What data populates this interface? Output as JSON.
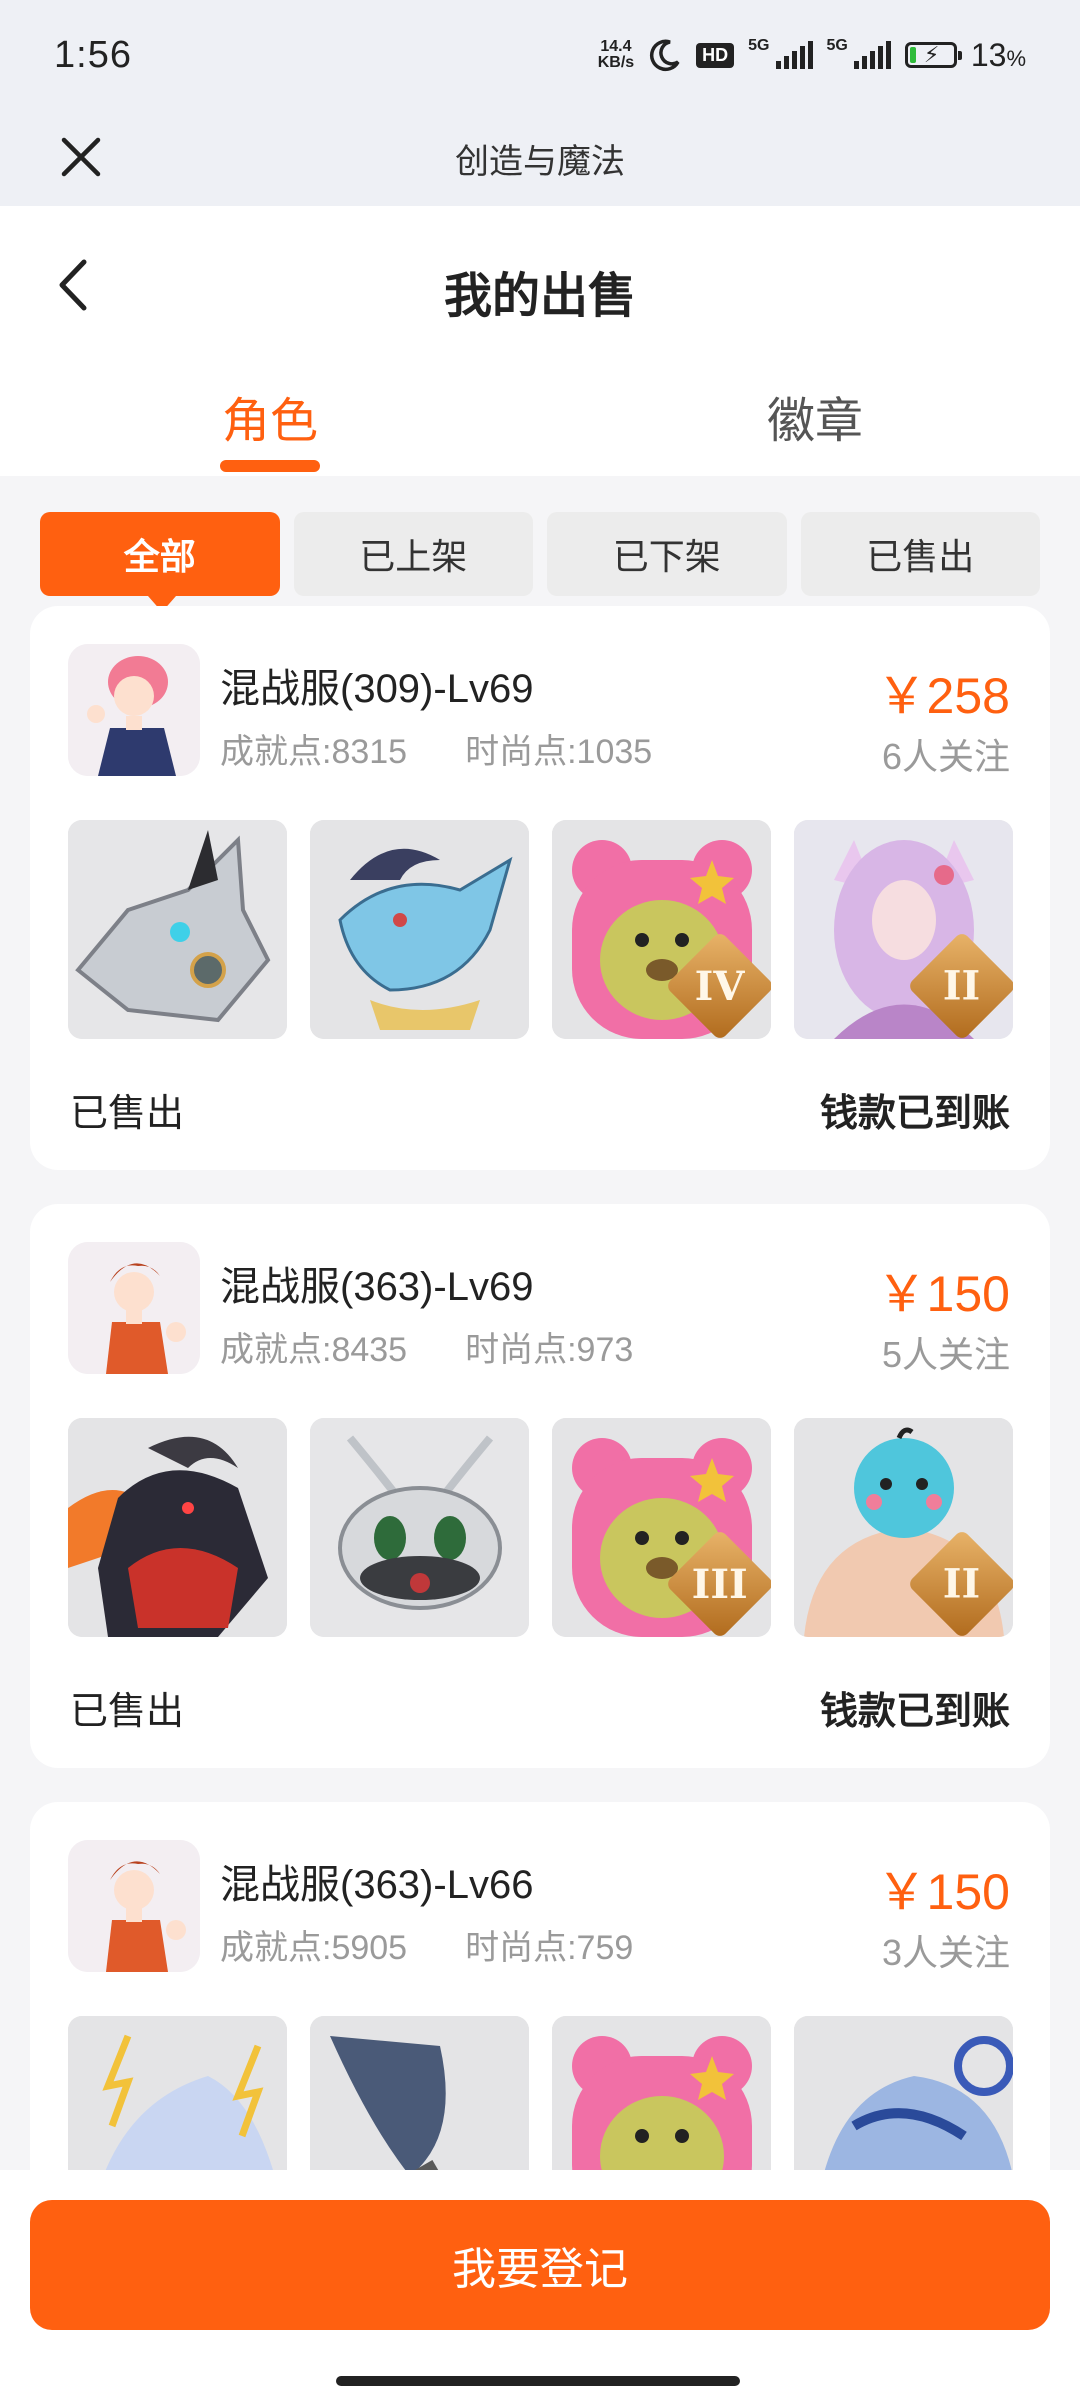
{
  "status_bar": {
    "time": "1:56",
    "net_speed_value": "14.4",
    "net_speed_unit": "KB/s",
    "hd_label": "HD",
    "signal1_label": "5G",
    "signal2_label": "5G",
    "battery_percent": "13",
    "battery_percent_sign": "%"
  },
  "mini_program": {
    "title": "创造与魔法"
  },
  "page": {
    "title": "我的出售",
    "tabs": [
      {
        "label": "角色",
        "active": true
      },
      {
        "label": "徽章",
        "active": false
      }
    ],
    "filters": [
      {
        "label": "全部",
        "active": true
      },
      {
        "label": "已上架",
        "active": false
      },
      {
        "label": "已下架",
        "active": false
      },
      {
        "label": "已售出",
        "active": false
      }
    ]
  },
  "listings": [
    {
      "server": "混战服(309)-Lv69",
      "achievement": "成就点:8315",
      "fashion": "时尚点:1035",
      "price": "￥258",
      "followers": "6人关注",
      "status": "已售出",
      "payment": "钱款已到账",
      "thumbs": [
        {
          "icon": "silver-dragon-mount",
          "rank": ""
        },
        {
          "icon": "blue-dragon-mount",
          "rank": ""
        },
        {
          "icon": "pink-bear-pet",
          "rank": "IV"
        },
        {
          "icon": "fox-spirit-costume",
          "rank": "II"
        }
      ]
    },
    {
      "server": "混战服(363)-Lv69",
      "achievement": "成就点:8435",
      "fashion": "时尚点:973",
      "price": "￥150",
      "followers": "5人关注",
      "status": "已售出",
      "payment": "钱款已到账",
      "thumbs": [
        {
          "icon": "black-goat-beast-mount",
          "rank": ""
        },
        {
          "icon": "white-mecha-bug",
          "rank": ""
        },
        {
          "icon": "pink-bear-pet",
          "rank": "III"
        },
        {
          "icon": "blue-bird-muscle-costume",
          "rank": "II"
        }
      ]
    },
    {
      "server": "混战服(363)-Lv66",
      "achievement": "成就点:5905",
      "fashion": "时尚点:759",
      "price": "￥150",
      "followers": "3人关注",
      "status": "",
      "payment": "",
      "thumbs": [
        {
          "icon": "lightning-horse-mount",
          "rank": ""
        },
        {
          "icon": "spear-weapon",
          "rank": ""
        },
        {
          "icon": "pink-bear-pet",
          "rank": ""
        },
        {
          "icon": "ice-tiger-mount",
          "rank": ""
        }
      ]
    }
  ],
  "bottom": {
    "register_label": "我要登记"
  },
  "colors": {
    "accent": "#ff6010",
    "background": "#f5f5f7",
    "muted_text": "#9a9a9a"
  }
}
